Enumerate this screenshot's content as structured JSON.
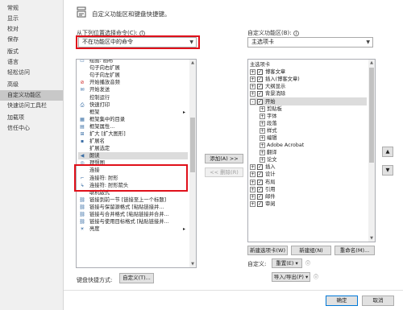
{
  "nav": {
    "items": [
      "常规",
      "显示",
      "校对",
      "保存",
      "版式",
      "语言",
      "轻松访问",
      "高级",
      "自定义功能区",
      "快速访问工具栏",
      "加载项",
      "信任中心"
    ],
    "selected_index": 8
  },
  "header": {
    "title": "自定义功能区和键盘快捷键。"
  },
  "left": {
    "label": "从下列位置选择命令(C):",
    "info_icon": "info-icon",
    "dropdown_value": "不在功能区中的命令",
    "items": [
      {
        "text": "绘图: 画布",
        "icon": "doc-icon"
      },
      {
        "text": "句子向右扩展",
        "icon": ""
      },
      {
        "text": "句子向左扩展",
        "icon": ""
      },
      {
        "text": "开始播放音频",
        "icon": "no-audio-icon"
      },
      {
        "text": "开始发送",
        "icon": "send-icon"
      },
      {
        "text": "控制运行",
        "icon": ""
      },
      {
        "text": "快速打印",
        "icon": "print-icon"
      },
      {
        "text": "框架",
        "icon": "",
        "submenu": true
      },
      {
        "text": "框架集中的目录",
        "icon": "frameset-icon"
      },
      {
        "text": "框架属性...",
        "icon": "frame-props-icon"
      },
      {
        "text": "扩大 [扩大图形]",
        "icon": "enlarge-icon"
      },
      {
        "text": "扩展名",
        "icon": "ext-icon"
      },
      {
        "text": "扩展选定",
        "icon": ""
      },
      {
        "text": "朗读",
        "icon": "speaker-icon"
      },
      {
        "text": "理想图",
        "icon": "ideal-icon"
      },
      {
        "text": "连接",
        "icon": ""
      },
      {
        "text": "连接符: 肘形",
        "icon": "elbow-icon"
      },
      {
        "text": "连接符: 肘形箭头",
        "icon": "elbow-arrow-icon"
      },
      {
        "text": "联机版式",
        "icon": ""
      },
      {
        "text": "链接到前一节 [链接至上一个标题]",
        "icon": "link-icon"
      },
      {
        "text": "链接与保留源格式 [粘贴链接并...",
        "icon": "link-icon"
      },
      {
        "text": "链接与合并格式 [粘贴链接并合并...",
        "icon": "link-icon"
      },
      {
        "text": "链接与使用目标格式 [粘贴链接并...",
        "icon": "link-icon"
      },
      {
        "text": "亮度",
        "icon": "sun-icon",
        "submenu": true
      }
    ],
    "highlight_index": 13
  },
  "middle": {
    "add_label": "添加(A) >>",
    "remove_label": "<< 删除(R)"
  },
  "right": {
    "label": "自定义功能区(B):",
    "dropdown_value": "主选项卡",
    "items": [
      {
        "text": "主选项卡",
        "level": 0,
        "exp": "",
        "cb": false
      },
      {
        "text": "博客文章",
        "level": 0,
        "exp": "+",
        "cb": true
      },
      {
        "text": "插入(博客文章)",
        "level": 0,
        "exp": "+",
        "cb": true
      },
      {
        "text": "大纲显示",
        "level": 0,
        "exp": "+",
        "cb": true
      },
      {
        "text": "背景消除",
        "level": 0,
        "exp": "+",
        "cb": true
      },
      {
        "text": "开始",
        "level": 0,
        "exp": "-",
        "cb": true,
        "hl": true
      },
      {
        "text": "剪贴板",
        "level": 1,
        "exp": "+",
        "cb": false
      },
      {
        "text": "字体",
        "level": 1,
        "exp": "+",
        "cb": false
      },
      {
        "text": "段落",
        "level": 1,
        "exp": "+",
        "cb": false
      },
      {
        "text": "样式",
        "level": 1,
        "exp": "+",
        "cb": false
      },
      {
        "text": "编辑",
        "level": 1,
        "exp": "+",
        "cb": false
      },
      {
        "text": "Adobe Acrobat",
        "level": 1,
        "exp": "+",
        "cb": false
      },
      {
        "text": "翻译",
        "level": 1,
        "exp": "+",
        "cb": false
      },
      {
        "text": "论文",
        "level": 1,
        "exp": "+",
        "cb": false
      },
      {
        "text": "插入",
        "level": 0,
        "exp": "+",
        "cb": true
      },
      {
        "text": "设计",
        "level": 0,
        "exp": "+",
        "cb": true
      },
      {
        "text": "布局",
        "level": 0,
        "exp": "+",
        "cb": true
      },
      {
        "text": "引用",
        "level": 0,
        "exp": "+",
        "cb": true
      },
      {
        "text": "邮件",
        "level": 0,
        "exp": "+",
        "cb": true
      },
      {
        "text": "审阅",
        "level": 0,
        "exp": "+",
        "cb": true
      }
    ]
  },
  "right_buttons": {
    "new_tab": "新建选项卡(W)",
    "new_group": "新建组(N)",
    "rename": "重命名(M)...",
    "custom_label": "自定义:",
    "reset": "重置(E) ▾",
    "import_export": "导入/导出(P) ▾"
  },
  "keyboard": {
    "label": "键盘快捷方式:",
    "button": "自定义(T)..."
  },
  "footer": {
    "ok": "确定",
    "cancel": "取消"
  },
  "colors": {
    "highlight_box": "#e0101a",
    "nav_selected": "#c8c8c8"
  }
}
